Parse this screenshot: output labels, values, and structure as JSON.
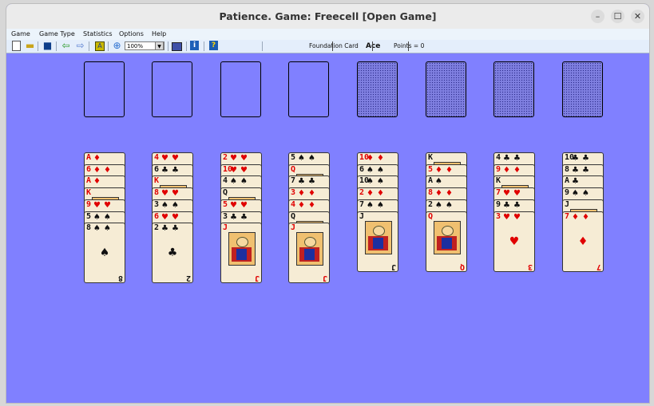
{
  "window": {
    "title": "Patience. Game: Freecell  [Open Game]",
    "minimize": "–",
    "maximize": "☐",
    "close": "✕"
  },
  "menu": [
    "Game",
    "Game Type",
    "Statistics",
    "Options",
    "Help"
  ],
  "toolbar": {
    "zoom": "100%",
    "foundation_label": "Foundation Card",
    "foundation_value": "Ace",
    "points_label": "Points = 0"
  },
  "colors": {
    "table": "#8080ff",
    "card_face": "#f6ecd5",
    "red_suit": "#e00000",
    "black_suit": "#111111"
  },
  "free_cells": [
    "empty",
    "empty",
    "empty",
    "empty"
  ],
  "foundations": [
    "empty",
    "empty",
    "empty",
    "empty"
  ],
  "tableau": [
    [
      {
        "rank": "A",
        "suit": "♦",
        "color": "r"
      },
      {
        "rank": "6",
        "suit": "♦",
        "color": "r"
      },
      {
        "rank": "A",
        "suit": "♦",
        "color": "r"
      },
      {
        "rank": "K",
        "suit": "♦",
        "color": "r"
      },
      {
        "rank": "9",
        "suit": "♥",
        "color": "r"
      },
      {
        "rank": "5",
        "suit": "♠",
        "color": "b"
      },
      {
        "rank": "8",
        "suit": "♠",
        "color": "b"
      }
    ],
    [
      {
        "rank": "4",
        "suit": "♥",
        "color": "r"
      },
      {
        "rank": "6",
        "suit": "♣",
        "color": "b"
      },
      {
        "rank": "K",
        "suit": "♥",
        "color": "r"
      },
      {
        "rank": "8",
        "suit": "♥",
        "color": "r"
      },
      {
        "rank": "3",
        "suit": "♠",
        "color": "b"
      },
      {
        "rank": "6",
        "suit": "♥",
        "color": "r"
      },
      {
        "rank": "2",
        "suit": "♣",
        "color": "b"
      }
    ],
    [
      {
        "rank": "2",
        "suit": "♥",
        "color": "r"
      },
      {
        "rank": "10",
        "suit": "♥",
        "color": "r"
      },
      {
        "rank": "4",
        "suit": "♠",
        "color": "b"
      },
      {
        "rank": "Q",
        "suit": "♣",
        "color": "b"
      },
      {
        "rank": "5",
        "suit": "♥",
        "color": "r"
      },
      {
        "rank": "3",
        "suit": "♣",
        "color": "b"
      },
      {
        "rank": "J",
        "suit": "♥",
        "color": "r"
      }
    ],
    [
      {
        "rank": "5",
        "suit": "♠",
        "color": "b"
      },
      {
        "rank": "Q",
        "suit": "♦",
        "color": "r"
      },
      {
        "rank": "7",
        "suit": "♣",
        "color": "b"
      },
      {
        "rank": "3",
        "suit": "♦",
        "color": "r"
      },
      {
        "rank": "4",
        "suit": "♦",
        "color": "r"
      },
      {
        "rank": "Q",
        "suit": "♠",
        "color": "b"
      },
      {
        "rank": "J",
        "suit": "♦",
        "color": "r"
      }
    ],
    [
      {
        "rank": "10",
        "suit": "♦",
        "color": "r"
      },
      {
        "rank": "6",
        "suit": "♠",
        "color": "b"
      },
      {
        "rank": "10",
        "suit": "♠",
        "color": "b"
      },
      {
        "rank": "2",
        "suit": "♦",
        "color": "r"
      },
      {
        "rank": "7",
        "suit": "♠",
        "color": "b"
      },
      {
        "rank": "J",
        "suit": "♠",
        "color": "b"
      }
    ],
    [
      {
        "rank": "K",
        "suit": "♠",
        "color": "b"
      },
      {
        "rank": "5",
        "suit": "♦",
        "color": "r"
      },
      {
        "rank": "A",
        "suit": "♠",
        "color": "b"
      },
      {
        "rank": "8",
        "suit": "♦",
        "color": "r"
      },
      {
        "rank": "2",
        "suit": "♠",
        "color": "b"
      },
      {
        "rank": "Q",
        "suit": "♥",
        "color": "r"
      }
    ],
    [
      {
        "rank": "4",
        "suit": "♣",
        "color": "b"
      },
      {
        "rank": "9",
        "suit": "♦",
        "color": "r"
      },
      {
        "rank": "K",
        "suit": "♣",
        "color": "b"
      },
      {
        "rank": "7",
        "suit": "♥",
        "color": "r"
      },
      {
        "rank": "9",
        "suit": "♣",
        "color": "b"
      },
      {
        "rank": "3",
        "suit": "♥",
        "color": "r"
      }
    ],
    [
      {
        "rank": "10",
        "suit": "♣",
        "color": "b"
      },
      {
        "rank": "8",
        "suit": "♣",
        "color": "b"
      },
      {
        "rank": "A",
        "suit": "♣",
        "color": "b"
      },
      {
        "rank": "9",
        "suit": "♠",
        "color": "b"
      },
      {
        "rank": "J",
        "suit": "♣",
        "color": "b"
      },
      {
        "rank": "7",
        "suit": "♦",
        "color": "r"
      }
    ]
  ]
}
